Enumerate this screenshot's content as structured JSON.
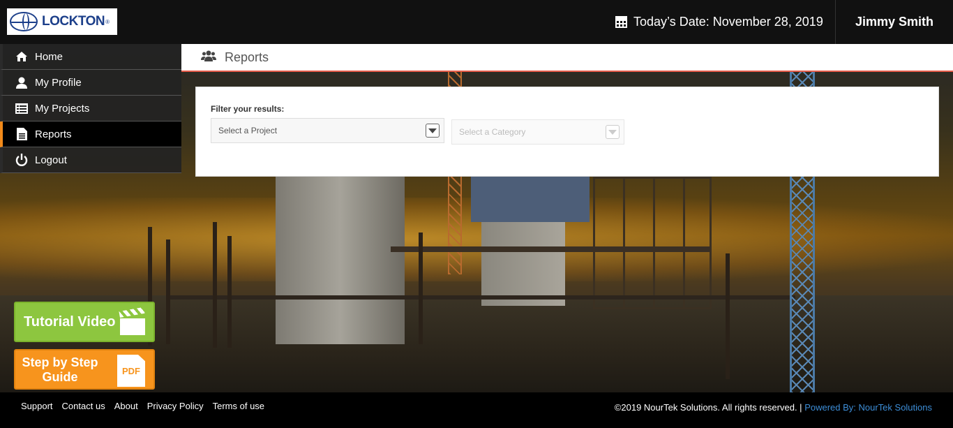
{
  "header": {
    "logo_text": "LOCKTON",
    "logo_reg": "®",
    "date_label": "Today’s Date: November 28, 2019",
    "user_name": "Jimmy Smith"
  },
  "sidebar": {
    "items": [
      {
        "label": "Home",
        "icon": "home-icon",
        "active": false
      },
      {
        "label": "My Profile",
        "icon": "user-icon",
        "active": false
      },
      {
        "label": "My Projects",
        "icon": "list-icon",
        "active": false
      },
      {
        "label": "Reports",
        "icon": "document-icon",
        "active": true
      },
      {
        "label": "Logout",
        "icon": "power-icon",
        "active": false
      }
    ]
  },
  "page": {
    "title": "Reports",
    "title_icon": "users-icon"
  },
  "filter": {
    "label": "Filter your results:",
    "project_select": "Select a Project",
    "category_select": "Select a Category"
  },
  "buttons": {
    "tutorial": "Tutorial Video",
    "guide_line1": "Step by Step",
    "guide_line2": "Guide",
    "pdf_text": "PDF"
  },
  "footer": {
    "links": [
      "Support",
      "Contact us",
      "About",
      "Privacy Policy",
      "Terms of use"
    ],
    "copyright": "©2019 NourTek Solutions. All rights reserved. |",
    "powered": "Powered By: NourTek Solutions"
  },
  "colors": {
    "accent_orange": "#f28a1a",
    "title_underline": "#e85c4a",
    "tutorial_green": "#8dc63f",
    "guide_orange": "#f7941d",
    "link_blue": "#3d8ed8"
  }
}
